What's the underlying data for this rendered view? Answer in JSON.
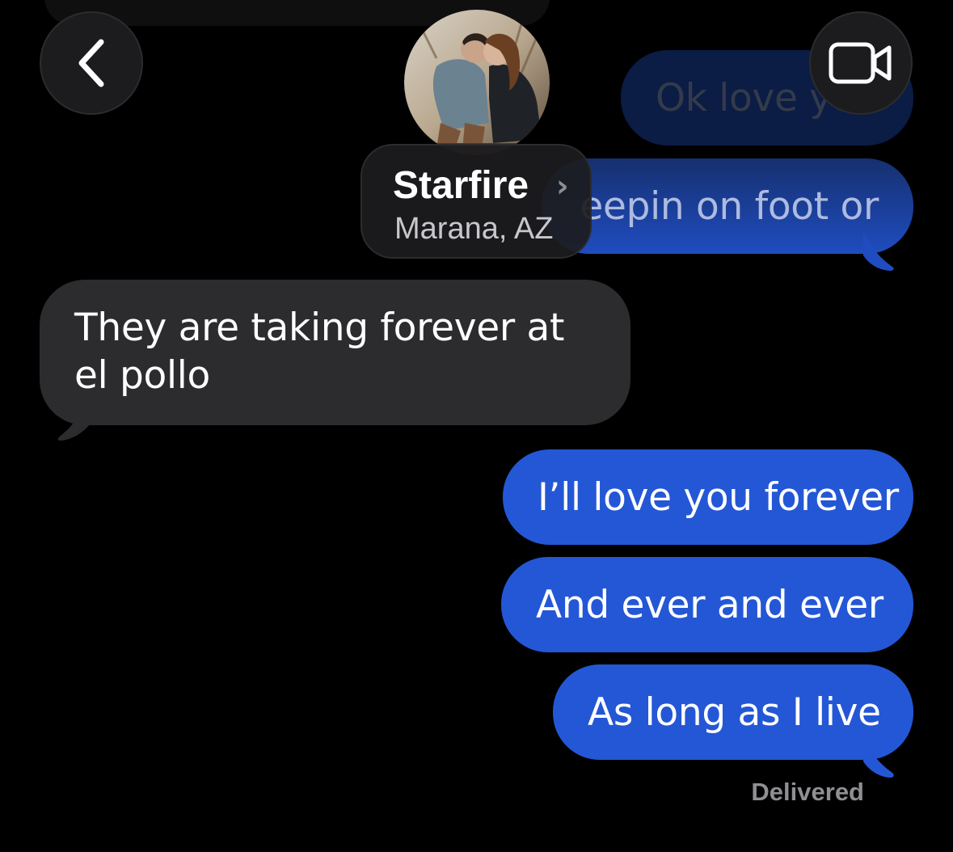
{
  "header": {
    "contact_name": "Starfire",
    "contact_location": "Marana, AZ",
    "back_icon": "chevron-left-icon",
    "video_icon": "video-camera-icon",
    "chevron_icon": "chevron-right-icon"
  },
  "messages": {
    "faded_out_1": "Ok love yo",
    "faded_out_2": "eepin on foot or",
    "incoming_1": "They are taking forever at el pollo",
    "out_1": "I’ll love you forever",
    "out_2": "And ever and ever",
    "out_3": "As long as I live"
  },
  "status": {
    "delivered": "Delivered"
  },
  "colors": {
    "outgoing_bubble": "#2457d6",
    "incoming_bubble": "#2c2c2e",
    "background": "#000000"
  }
}
